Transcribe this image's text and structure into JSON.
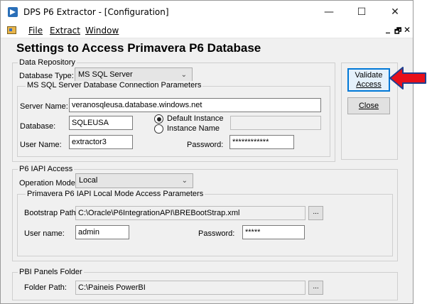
{
  "window": {
    "title": "DPS P6 Extractor - [Configuration]"
  },
  "title_controls": {
    "minimize": "—",
    "maximize": "☐",
    "close": "✕"
  },
  "menu": {
    "file": "File",
    "extract": "Extract",
    "window": "Window"
  },
  "mdi_controls": {
    "minimize": "_",
    "restore": "🗗",
    "close": "✕"
  },
  "heading": "Settings to Access Primavera P6 Database",
  "data_repository": {
    "label": "Data Repository",
    "db_type_label": "Database Type:",
    "db_type_value": "MS SQL Server",
    "sql": {
      "label": "MS SQL Server Database Connection Parameters",
      "server_label": "Server Name:",
      "server_value": "veranosqleusa.database.windows.net",
      "database_label": "Database:",
      "database_value": "SQLEUSA",
      "default_instance": "Default Instance",
      "instance_name": "Instance Name",
      "instance_value": "",
      "user_label": "User Name:",
      "user_value": "extractor3",
      "password_label": "Password:",
      "password_value": "************"
    }
  },
  "buttons": {
    "validate_line1": "Validate",
    "validate_line2": "Access",
    "close": "Close"
  },
  "iapi": {
    "label": "P6 IAPI Access",
    "mode_label": "Operation Mode:",
    "mode_value": "Local",
    "local": {
      "label": "Primavera P6 IAPI Local Mode Access Parameters",
      "bootstrap_label": "Bootstrap Path:",
      "bootstrap_value": "C:\\Oracle\\P6IntegrationAPI\\BREBootStrap.xml",
      "browse": "...",
      "user_label": "User name:",
      "user_value": "admin",
      "password_label": "Password:",
      "password_value": "*****"
    }
  },
  "pbi": {
    "label": "PBI Panels Folder",
    "folder_label": "Folder Path:",
    "folder_value": "C:\\Paineis PowerBI",
    "browse": "..."
  },
  "colors": {
    "accent": "#0078d7",
    "arrow": "#e8101a",
    "arrow_outline": "#1f3f8f",
    "window_bg": "#f0f0f0"
  },
  "icons": {
    "app": "app-icon",
    "menu": "document-icon",
    "dropdown": "chevron-down-icon",
    "arrow": "red-arrow-icon"
  }
}
